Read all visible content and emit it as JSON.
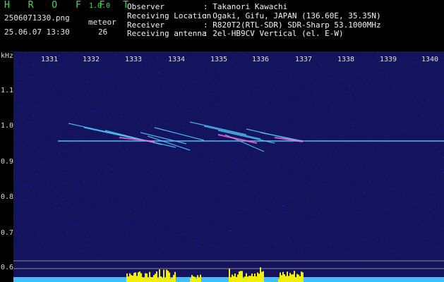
{
  "app": {
    "brand": "H R O F F T",
    "version": "1.0.0",
    "filename": "2506071330.png",
    "meteor_label": "meteor",
    "datetime": "25.06.07 13:30",
    "meteor_count": "26"
  },
  "info": [
    {
      "key": "Observer",
      "value": ": Takanori Kawachi"
    },
    {
      "key": "Receiving Location",
      "value": ": Ogaki, Gifu, JAPAN (136.60E, 35.35N)"
    },
    {
      "key": "Receiver",
      "value": ": R820T2(RTL-SDR) SDR-Sharp 53.1000MHz"
    },
    {
      "key": "Receiving antenna",
      "value": ": 2el-HB9CV Vertical (el. E-W)"
    }
  ],
  "axis": {
    "unit": "kHz",
    "x_ticks": [
      "1331",
      "1332",
      "1333",
      "1334",
      "1335",
      "1336",
      "1337",
      "1338",
      "1339",
      "1340"
    ],
    "y_ticks": [
      "1.1",
      "1.0",
      "0.9",
      "0.8",
      "0.7",
      "0.6"
    ]
  },
  "colors": {
    "background": "#14145e",
    "carrier": "#4fd0ff",
    "echo": "#ff6bd8",
    "meter_bar": "#f2f000",
    "meter_base": "#3fc0ff",
    "brand": "#3fe04a"
  }
}
